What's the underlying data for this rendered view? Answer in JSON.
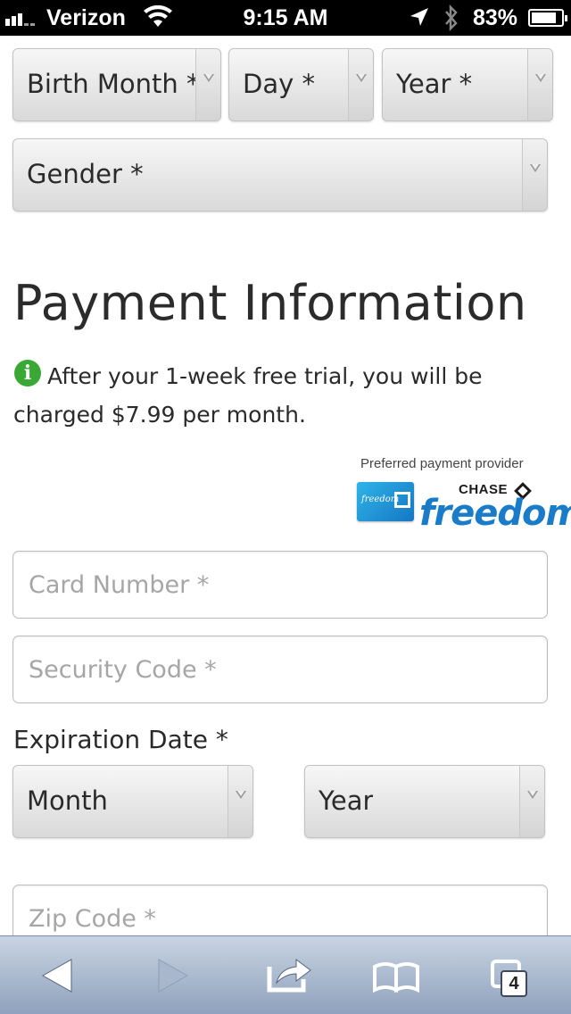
{
  "status_bar": {
    "carrier": "Verizon",
    "time": "9:15 AM",
    "battery_percent": "83%",
    "battery_level": 0.83,
    "icons": [
      "signal-bars-icon",
      "wifi-icon",
      "location-arrow-icon",
      "bluetooth-icon",
      "battery-icon"
    ]
  },
  "birth": {
    "month_label": "Birth Month *",
    "day_label": "Day *",
    "year_label": "Year *"
  },
  "gender_label": "Gender *",
  "payment": {
    "title": "Payment Information",
    "info_icon": "i",
    "info_text": "After your 1-week free trial, you will be charged $7.99 per month.",
    "provider_label": "Preferred payment provider",
    "card_word": "freedom",
    "brand_chase": "CHASE",
    "brand_freedom": "freedom",
    "card_number_placeholder": "Card Number *",
    "security_code_placeholder": "Security Code *",
    "expiration_label": "Expiration Date *",
    "exp_month_label": "Month",
    "exp_year_label": "Year",
    "zip_placeholder": "Zip Code *"
  },
  "toolbar": {
    "tab_count": "4",
    "icons": [
      "back-arrow-icon",
      "forward-arrow-icon",
      "share-icon",
      "bookmarks-icon",
      "tabs-icon"
    ]
  },
  "colors": {
    "info_green": "#3aa835",
    "freedom_blue": "#1a7cc9",
    "toolbar_top": "#c9d4e3",
    "toolbar_bottom": "#8fa1bc"
  }
}
